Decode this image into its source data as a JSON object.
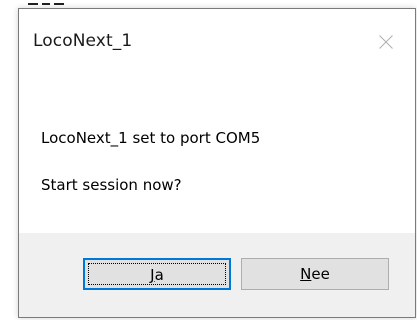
{
  "dialog": {
    "title": "LocoNext_1",
    "message_line1": "LocoNext_1 set to port COM5",
    "message_line2": "Start session now?",
    "close_icon": "close-icon"
  },
  "buttons": {
    "yes": {
      "mnemonic": "J",
      "rest": "a",
      "label": "Ja"
    },
    "no": {
      "mnemonic": "N",
      "rest": "ee",
      "label": "Nee"
    }
  },
  "colors": {
    "accent_focus": "#0078d7",
    "footer_bg": "#f0f0f0",
    "button_bg": "#e1e1e1"
  }
}
